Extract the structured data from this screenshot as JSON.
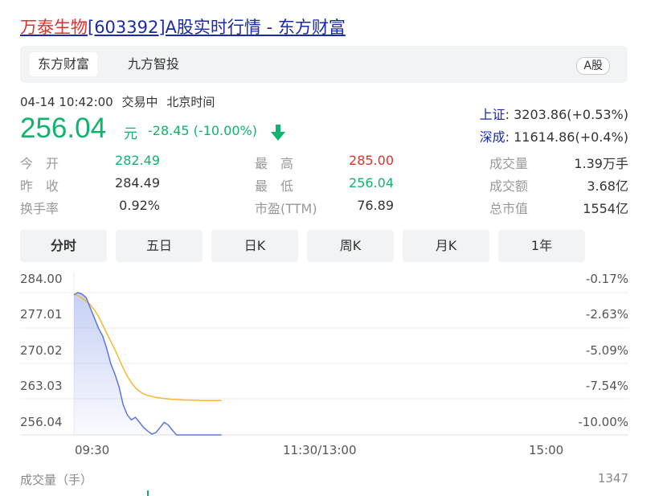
{
  "page_title": {
    "stock_name": "万泰生物",
    "rest": "[603392]A股实时行情 - 东方财富"
  },
  "tabs": [
    "东方财富",
    "九方智投"
  ],
  "market_badge": "A股",
  "datetime": "04-14 10:42:00",
  "trade_status": "交易中",
  "timezone": "北京时间",
  "price": "256.04",
  "price_unit": "元",
  "change": "-28.45",
  "change_pct": "(-10.00%)",
  "indices": [
    {
      "label": "上证",
      "value": ": 3203.86(+0.53%)"
    },
    {
      "label": "深成",
      "value": ": 11614.86(+0.4%)"
    }
  ],
  "stats": {
    "open_label": "今　开",
    "open": "282.49",
    "prev_label": "昨　收",
    "prev": "284.49",
    "turnover_label": "换手率",
    "turnover": "0.92%",
    "high_label": "最　高",
    "high": "285.00",
    "low_label": "最　低",
    "low": "256.04",
    "pe_label": "市盈(TTM)",
    "pe": "76.89",
    "volume_label": "成交量",
    "volume": "1.39万手",
    "amount_label": "成交额",
    "amount": "3.68亿",
    "mcap_label": "总市值",
    "mcap": "1554亿"
  },
  "periods": [
    "分时",
    "五日",
    "日K",
    "周K",
    "月K",
    "1年"
  ],
  "active_period": "分时",
  "chart": {
    "y_left": [
      "284.00",
      "277.01",
      "270.02",
      "263.03",
      "256.04"
    ],
    "y_right": [
      "-0.17%",
      "-2.63%",
      "-5.09%",
      "-7.54%",
      "-10.00%"
    ],
    "x": [
      "09:30",
      "11:30/13:00",
      "15:00"
    ],
    "volume_title": "成交量（手）",
    "volume_max": "1347"
  },
  "colors": {
    "up": "#e0302b",
    "down": "#0eb46e",
    "link": "#1a2ba8",
    "price_line": "#5a78e0",
    "avg_line": "#f5b82e"
  },
  "chart_data": {
    "type": "line",
    "title": "",
    "xlabel": "",
    "ylabel": "",
    "ylim": [
      256.04,
      284.0
    ],
    "x_ticks": [
      "09:30",
      "11:30/13:00",
      "15:00"
    ],
    "series": [
      {
        "values": [
          283.6,
          284.0,
          283.7,
          283.0,
          281.0,
          279.0,
          277.0,
          275.5,
          273.0,
          270.0,
          268.0,
          265.5,
          262.0,
          260.0,
          259.0,
          259.5,
          258.5,
          257.5,
          256.8,
          256.2,
          256.5,
          257.5,
          258.5,
          258.0,
          257.0,
          256.04,
          256.04,
          256.04,
          256.04,
          256.04,
          256.04,
          256.04,
          256.04,
          256.04,
          256.04,
          256.04,
          256.04
        ]
      },
      {
        "values": [
          283.6,
          283.4,
          282.9,
          282.3,
          281.6,
          280.6,
          279.3,
          277.7,
          276.0,
          274.4,
          272.8,
          271.0,
          269.2,
          267.6,
          266.3,
          265.3,
          264.6,
          264.1,
          263.8,
          263.6,
          263.4,
          263.3,
          263.2,
          263.1,
          263.0,
          263.0,
          262.95,
          262.9,
          262.9,
          262.85,
          262.85,
          262.8,
          262.8,
          262.8,
          262.8,
          262.8,
          262.8
        ]
      }
    ]
  }
}
